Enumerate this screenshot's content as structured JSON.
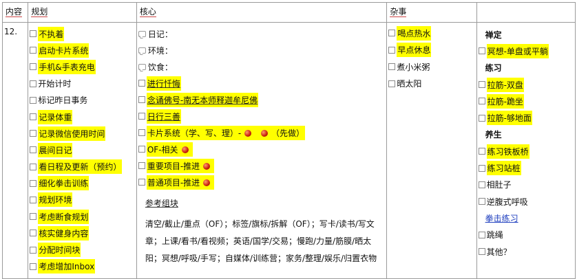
{
  "headers": [
    "内容",
    "规划",
    "核心",
    "杂事",
    ""
  ],
  "row_number": "12.",
  "plan_items": [
    {
      "text": "不执着",
      "hl": true
    },
    {
      "text": "启动卡片系统",
      "hl": true
    },
    {
      "text": "手机&手表充电",
      "hl": true
    },
    {
      "text": "开始计时",
      "hl": false
    },
    {
      "text": "标记昨日事务",
      "hl": false
    },
    {
      "text": "记录体重",
      "hl": true
    },
    {
      "text": "记录微信使用时间",
      "hl": true
    },
    {
      "text": "晨间日记",
      "hl": true
    },
    {
      "text": "看日程及更新（预约）",
      "hl": true
    },
    {
      "text": "细化拳击训练",
      "hl": true
    },
    {
      "text": "规划环境",
      "hl": true
    },
    {
      "text": "考虑断食规划",
      "hl": true
    },
    {
      "text": "核实健身内容",
      "hl": true
    },
    {
      "text": "分配时间块",
      "hl": true
    },
    {
      "text": "考虑增加Inbox",
      "hl": true
    }
  ],
  "core_items": [
    {
      "icon": "note",
      "text": "日记：",
      "hl": false
    },
    {
      "icon": "note",
      "text": "环境：",
      "hl": false
    },
    {
      "icon": "note",
      "text": "饮食：",
      "hl": false
    },
    {
      "icon": "cb",
      "text": "进行忏悔",
      "hl": true,
      "ul": true
    },
    {
      "icon": "cb",
      "text": "念诵佛号-南无本师释迦牟尼佛",
      "hl": true,
      "ul": true
    },
    {
      "icon": "cb",
      "text": "日行三善",
      "hl": true,
      "ul": true
    },
    {
      "icon": "cb",
      "text": "卡片系统（学、写、理）-",
      "suffix": "（先做）",
      "balls": 2,
      "hl": true
    },
    {
      "icon": "cb",
      "text": "OF-相关",
      "balls": 1,
      "hl": true,
      "gap": true
    },
    {
      "icon": "cb",
      "text": "重要项目-推进",
      "balls": 1,
      "hl": true
    },
    {
      "icon": "cb",
      "text": "普通项目-推进",
      "balls": 1,
      "hl": true
    }
  ],
  "reference": {
    "title": "参考组块",
    "text": "清空/截止/重点（OF）；标签/旗标/拆解（OF）；写卡/读书/写文章；上课/看书/看视频；英语/国学/交易；慢跑/力量/筋膜/晒太阳；冥想/呼吸/手写；自媒体/训练营；家务/整理/娱乐/归置衣物"
  },
  "misc_items": [
    {
      "text": "喝点热水",
      "hl": true
    },
    {
      "text": "早点休息",
      "hl": true
    },
    {
      "text": "煮小米粥",
      "hl": false
    },
    {
      "text": "晒太阳",
      "hl": false
    }
  ],
  "extra_items": [
    {
      "type": "section",
      "text": "禅定"
    },
    {
      "type": "item",
      "text": "冥想-单盘或平躺",
      "hl": true
    },
    {
      "type": "section",
      "text": "练习"
    },
    {
      "type": "item",
      "text": "拉筋-双盘",
      "hl": true
    },
    {
      "type": "item",
      "text": "拉筋-跪坐",
      "hl": true
    },
    {
      "type": "item",
      "text": "拉筋-够地面",
      "hl": true
    },
    {
      "type": "section",
      "text": "养生"
    },
    {
      "type": "item",
      "text": "练习铁板桥",
      "hl": true
    },
    {
      "type": "item",
      "text": "练习站桩",
      "hl": true
    },
    {
      "type": "item",
      "text": "相肚子",
      "hl": false
    },
    {
      "type": "item",
      "text": "逆腹式呼吸",
      "hl": false
    },
    {
      "type": "link",
      "text": "拳击练习"
    },
    {
      "type": "item",
      "text": "跳绳",
      "hl": false
    },
    {
      "type": "item",
      "text": "其他？",
      "hl": false
    }
  ]
}
